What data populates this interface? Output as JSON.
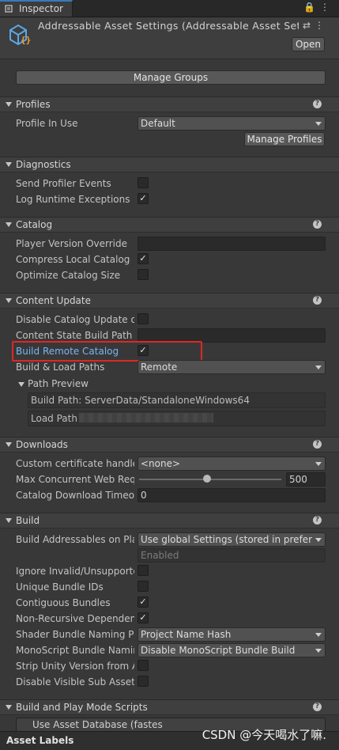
{
  "tab": {
    "label": "Inspector"
  },
  "header": {
    "title": "Addressable Asset Settings (Addressable Asset Sett",
    "open_label": "Open"
  },
  "manage_groups_label": "Manage Groups",
  "sections": {
    "profiles": "Profiles",
    "diagnostics": "Diagnostics",
    "catalog": "Catalog",
    "content_update": "Content Update",
    "downloads": "Downloads",
    "build": "Build",
    "play_mode": "Build and Play Mode Scripts"
  },
  "profiles": {
    "profile_in_use_label": "Profile In Use",
    "profile_in_use_value": "Default",
    "manage_profiles_label": "Manage Profiles"
  },
  "diagnostics": {
    "send_profiler_events": {
      "label": "Send Profiler Events",
      "checked": false
    },
    "log_runtime_exceptions": {
      "label": "Log Runtime Exceptions",
      "checked": true
    }
  },
  "catalog": {
    "player_version_override": {
      "label": "Player Version Override",
      "value": ""
    },
    "compress_local_catalog": {
      "label": "Compress Local Catalog",
      "checked": true
    },
    "optimize_catalog_size": {
      "label": "Optimize Catalog Size",
      "checked": false
    }
  },
  "content_update": {
    "disable_catalog_update": {
      "label": "Disable Catalog Update on",
      "checked": false
    },
    "content_state_build_path": {
      "label": "Content State Build Path",
      "value": ""
    },
    "build_remote_catalog": {
      "label": "Build Remote Catalog",
      "checked": true
    },
    "build_load_paths": {
      "label": "Build & Load Paths",
      "value": "Remote"
    },
    "path_preview_label": "Path Preview",
    "build_path": "Build Path: ServerData/StandaloneWindows64",
    "load_path": "Load Path"
  },
  "downloads": {
    "custom_cert": {
      "label": "Custom certificate handler",
      "value": "<none>"
    },
    "max_concurrent": {
      "label": "Max Concurrent Web Reque",
      "value": "500",
      "slider_fraction": 0.47
    },
    "catalog_timeout": {
      "label": "Catalog Download Timeout",
      "value": "0"
    }
  },
  "build": {
    "build_addressables_on_play": {
      "label": "Build Addressables on Play",
      "value": "Use global Settings (stored in preference",
      "sub_value": "Enabled"
    },
    "ignore_invalid": {
      "label": "Ignore Invalid/Unsupported",
      "checked": false
    },
    "unique_bundle_ids": {
      "label": "Unique Bundle IDs",
      "checked": false
    },
    "contiguous_bundles": {
      "label": "Contiguous Bundles",
      "checked": true
    },
    "non_recursive": {
      "label": "Non-Recursive Dependenc",
      "checked": true
    },
    "shader_naming": {
      "label": "Shader Bundle Naming Pref",
      "value": "Project Name Hash"
    },
    "monoscript_naming": {
      "label": "MonoScript Bundle Naming",
      "value": "Disable MonoScript Bundle Build"
    },
    "strip_unity_version": {
      "label": "Strip Unity Version from Ass",
      "checked": false
    },
    "disable_visible_sub": {
      "label": "Disable Visible Sub Asset R",
      "checked": false
    }
  },
  "play_mode": {
    "first_item": "Use Asset Database (fastes"
  },
  "footer": {
    "label": "Asset Labels",
    "watermark": "CSDN @今天喝水了嘛."
  }
}
